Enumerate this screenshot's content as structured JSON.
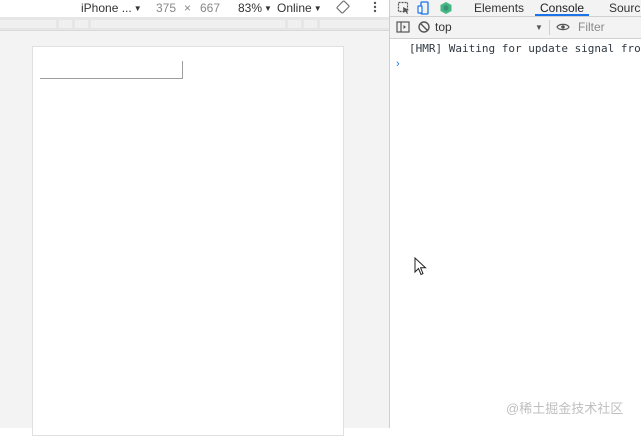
{
  "emulation": {
    "device": "iPhone ...",
    "width": "375",
    "times": "×",
    "height": "667",
    "zoom": "83%",
    "throttle": "Online"
  },
  "devtools": {
    "tabs": [
      {
        "label": "Elements",
        "active": false
      },
      {
        "label": "Console",
        "active": true
      },
      {
        "label": "Sourc",
        "active": false
      }
    ],
    "console": {
      "context": "top",
      "filter_placeholder": "Filter",
      "messages": [
        "[HMR] Waiting for update signal from"
      ],
      "prompt_symbol": "›"
    }
  },
  "watermark": "@稀土掘金技术社区",
  "colors": {
    "accent": "#1a73e8",
    "vue_green": "#42b883",
    "pane_bg": "#f3f3f3"
  }
}
